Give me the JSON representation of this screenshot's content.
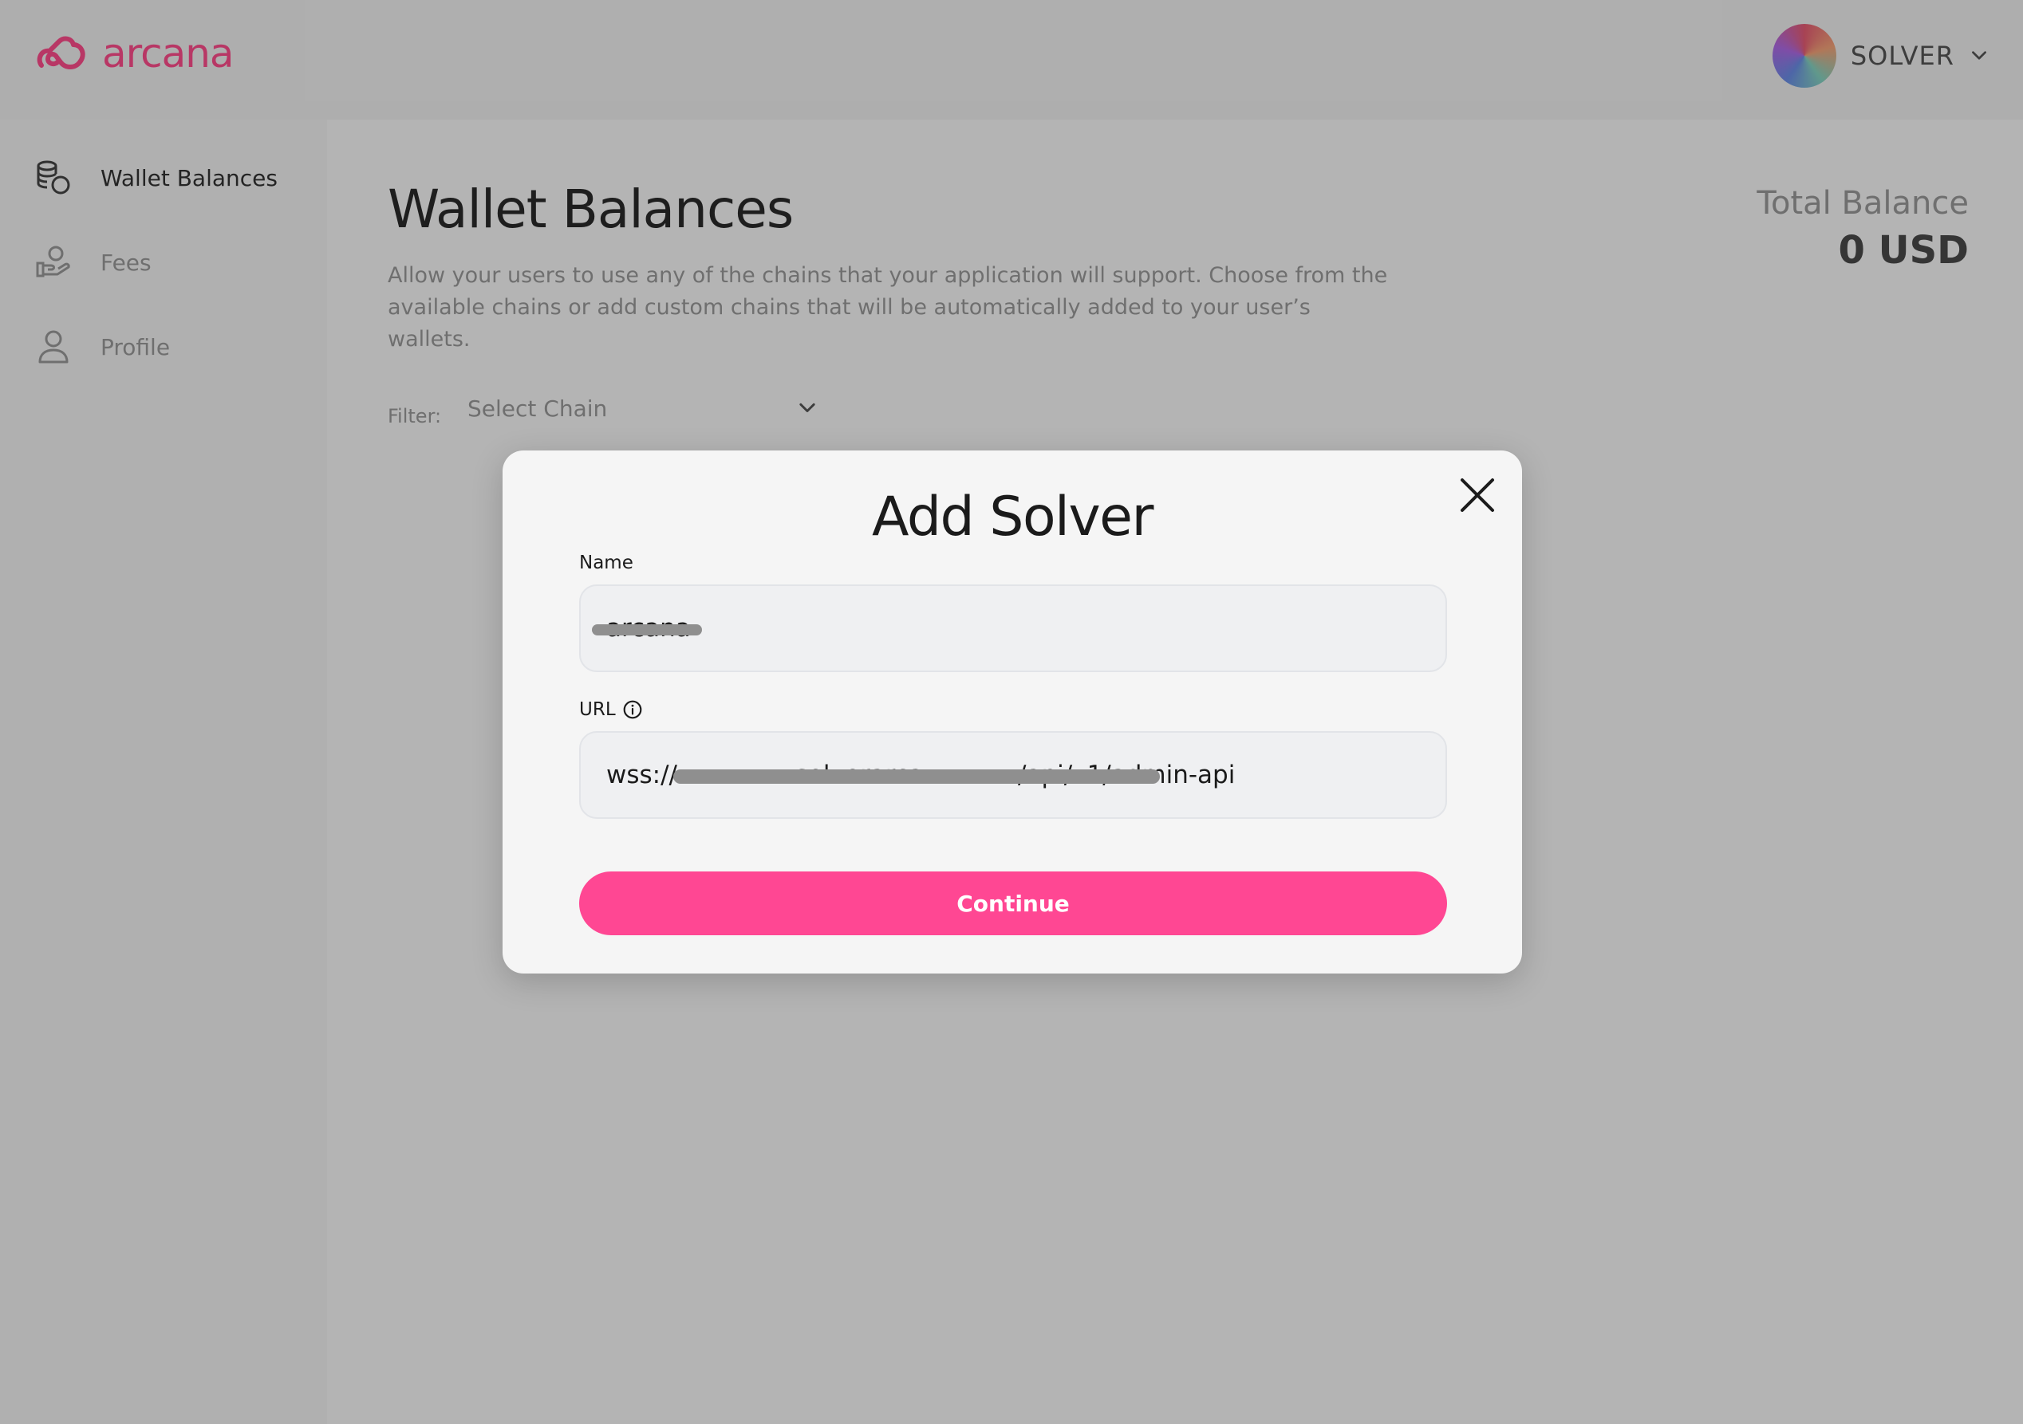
{
  "app": {
    "brand": "arcana",
    "accent_color": "#ff4793"
  },
  "header": {
    "account_label": "SOLVER",
    "account_icon": "chevron-down-icon"
  },
  "sidebar": {
    "items": [
      {
        "label": "Wallet Balances",
        "icon": "coins-wallet-icon",
        "active": true
      },
      {
        "label": "Fees",
        "icon": "hand-coins-icon",
        "active": false
      },
      {
        "label": "Profile",
        "icon": "user-icon",
        "active": false
      }
    ]
  },
  "main": {
    "title": "Wallet Balances",
    "description": "Allow your users to use any of the chains that your application will support. Choose from the available chains or add custom chains that will be automatically added to your user’s wallets.",
    "total_balance": {
      "label": "Total Balance",
      "value": "0 USD"
    },
    "filter": {
      "label": "Filter:",
      "placeholder": "Select Chain"
    }
  },
  "modal": {
    "title": "Add Solver",
    "name_field": {
      "label": "Name",
      "value": "arcana"
    },
    "url_field": {
      "label": "URL",
      "info_icon": "info-icon",
      "value": "wss://               solverarca            /api/v1/admin-api"
    },
    "continue_label": "Continue"
  }
}
